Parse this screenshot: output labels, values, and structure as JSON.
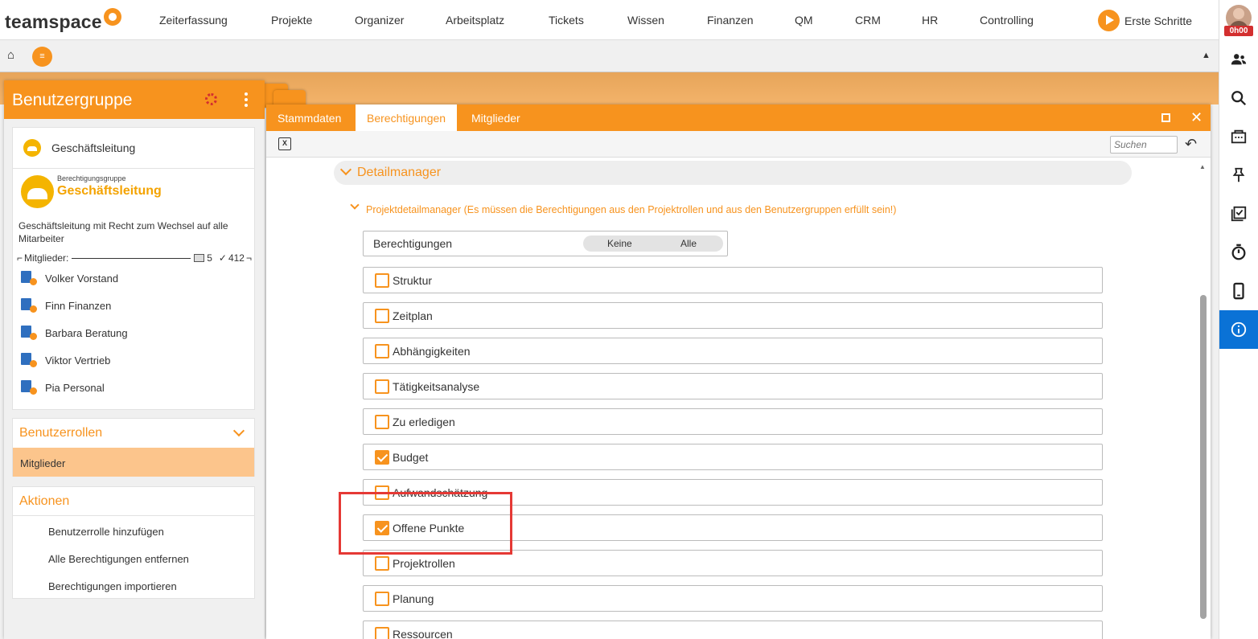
{
  "app": {
    "logo_text": "teamspace",
    "nav": [
      "Zeiterfassung",
      "Projekte",
      "Organizer",
      "Arbeitsplatz",
      "Tickets",
      "Wissen",
      "Finanzen",
      "QM",
      "CRM",
      "HR",
      "Controlling"
    ],
    "erste_schritte": "Erste Schritte",
    "time_badge": "0h00",
    "accent_color": "#f7931e",
    "active_icon_color": "#0a72d6"
  },
  "toolbar2": {
    "home_icon": "⌂",
    "menu_icon": "≡",
    "collapse_icon": "▲"
  },
  "left_panel": {
    "title": "Benutzergruppe",
    "group_name": "Geschäftsleitung",
    "group_type_label": "Berechtigungsgruppe",
    "group_title": "Geschäftsleitung",
    "group_description": "Geschäftsleitung mit Recht zum Wechsel auf alle Mitarbeiter",
    "members_label": "Mitglieder:",
    "members_count": "5",
    "members_checked": "412",
    "members": [
      "Volker Vorstand",
      "Finn Finanzen",
      "Barbara Beratung",
      "Viktor Vertrieb",
      "Pia Personal"
    ],
    "roles_title": "Benutzerrollen",
    "roles_selected": "Mitglieder",
    "actions_title": "Aktionen",
    "actions": [
      "Benutzerrolle hinzufügen",
      "Alle Berechtigungen entfernen",
      "Berechtigungen importieren"
    ]
  },
  "dialog": {
    "tabs": [
      "Stammdaten",
      "Berechtigungen",
      "Mitglieder"
    ],
    "active_tab": "Berechtigungen",
    "search_placeholder": "Suchen",
    "section_title": "Detailmanager",
    "subsection_title": "Projektdetailmanager (Es müssen die Berechtigungen aus den Projektrollen und aus den Benutzergruppen erfüllt sein!)",
    "permissions_header": "Berechtigungen",
    "toggle_none": "Keine",
    "toggle_all": "Alle",
    "permissions": [
      {
        "label": "Struktur",
        "checked": false
      },
      {
        "label": "Zeitplan",
        "checked": false
      },
      {
        "label": "Abhängigkeiten",
        "checked": false
      },
      {
        "label": "Tätigkeitsanalyse",
        "checked": false
      },
      {
        "label": "Zu erledigen",
        "checked": false
      },
      {
        "label": "Budget",
        "checked": true
      },
      {
        "label": "Aufwandschätzung",
        "checked": false
      },
      {
        "label": "Offene Punkte",
        "checked": true
      },
      {
        "label": "Projektrollen",
        "checked": false
      },
      {
        "label": "Planung",
        "checked": false
      },
      {
        "label": "Ressourcen",
        "checked": false
      }
    ]
  }
}
